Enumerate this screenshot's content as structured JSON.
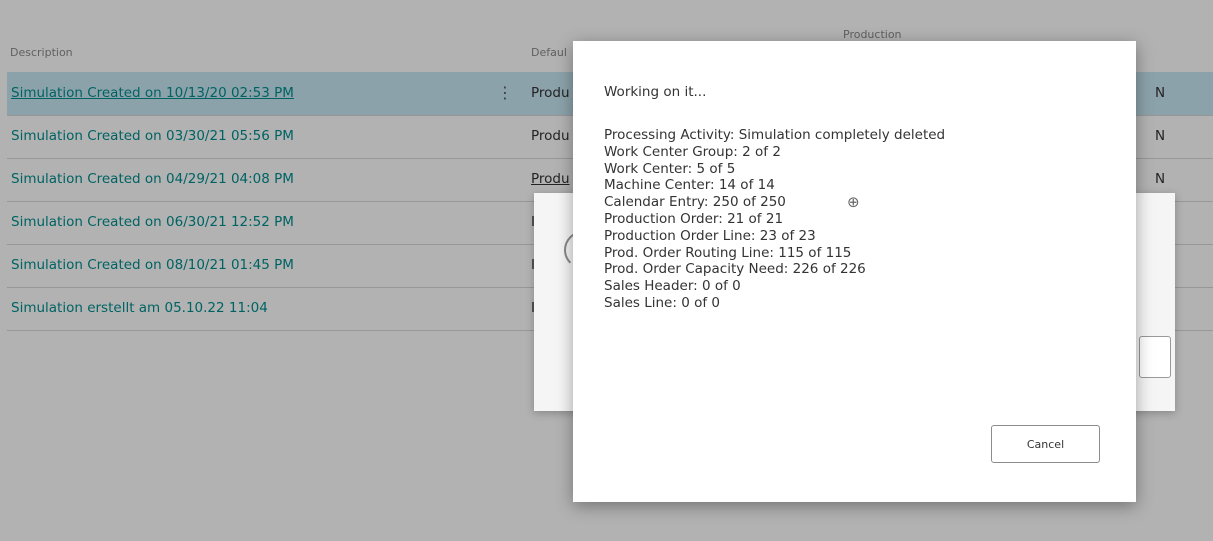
{
  "table": {
    "headers": {
      "description": "Description",
      "default_partial": "Defaul",
      "production": "Production"
    },
    "rows": [
      {
        "description": "Simulation Created on 10/13/20 02:53 PM",
        "default": "Produ",
        "default_link": false,
        "right": "N",
        "selected": true
      },
      {
        "description": "Simulation Created on 03/30/21 05:56 PM",
        "default": "Produ",
        "default_link": false,
        "right": "N",
        "selected": false
      },
      {
        "description": "Simulation Created on 04/29/21 04:08 PM",
        "default": "Produ",
        "default_link": true,
        "right": "N",
        "selected": false
      },
      {
        "description": "Simulation Created on 06/30/21 12:52 PM",
        "default": "I",
        "default_link": false,
        "right": "",
        "selected": false
      },
      {
        "description": "Simulation Created on 08/10/21 01:45 PM",
        "default": "I",
        "default_link": false,
        "right": "",
        "selected": false
      },
      {
        "description": "Simulation erstellt am 05.10.22 11:04",
        "default": "I",
        "default_link": false,
        "right": "",
        "selected": false
      }
    ],
    "row_menu_glyph": "⋮"
  },
  "dialog": {
    "title": "Working on it...",
    "lines": [
      "Processing Activity: Simulation completely deleted",
      "Work Center Group: 2 of 2",
      "Work Center: 5 of 5",
      "Machine Center: 14 of 14",
      "Calendar Entry: 250 of 250",
      "Production Order: 21 of 21",
      "Production Order Line: 23 of 23",
      "Prod. Order Routing Line: 115 of 115",
      "Prod. Order Capacity Need: 226 of 226",
      "Sales Header: 0 of 0",
      "Sales Line: 0 of 0"
    ],
    "cancel_label": "Cancel",
    "move_icon": "⊕"
  }
}
